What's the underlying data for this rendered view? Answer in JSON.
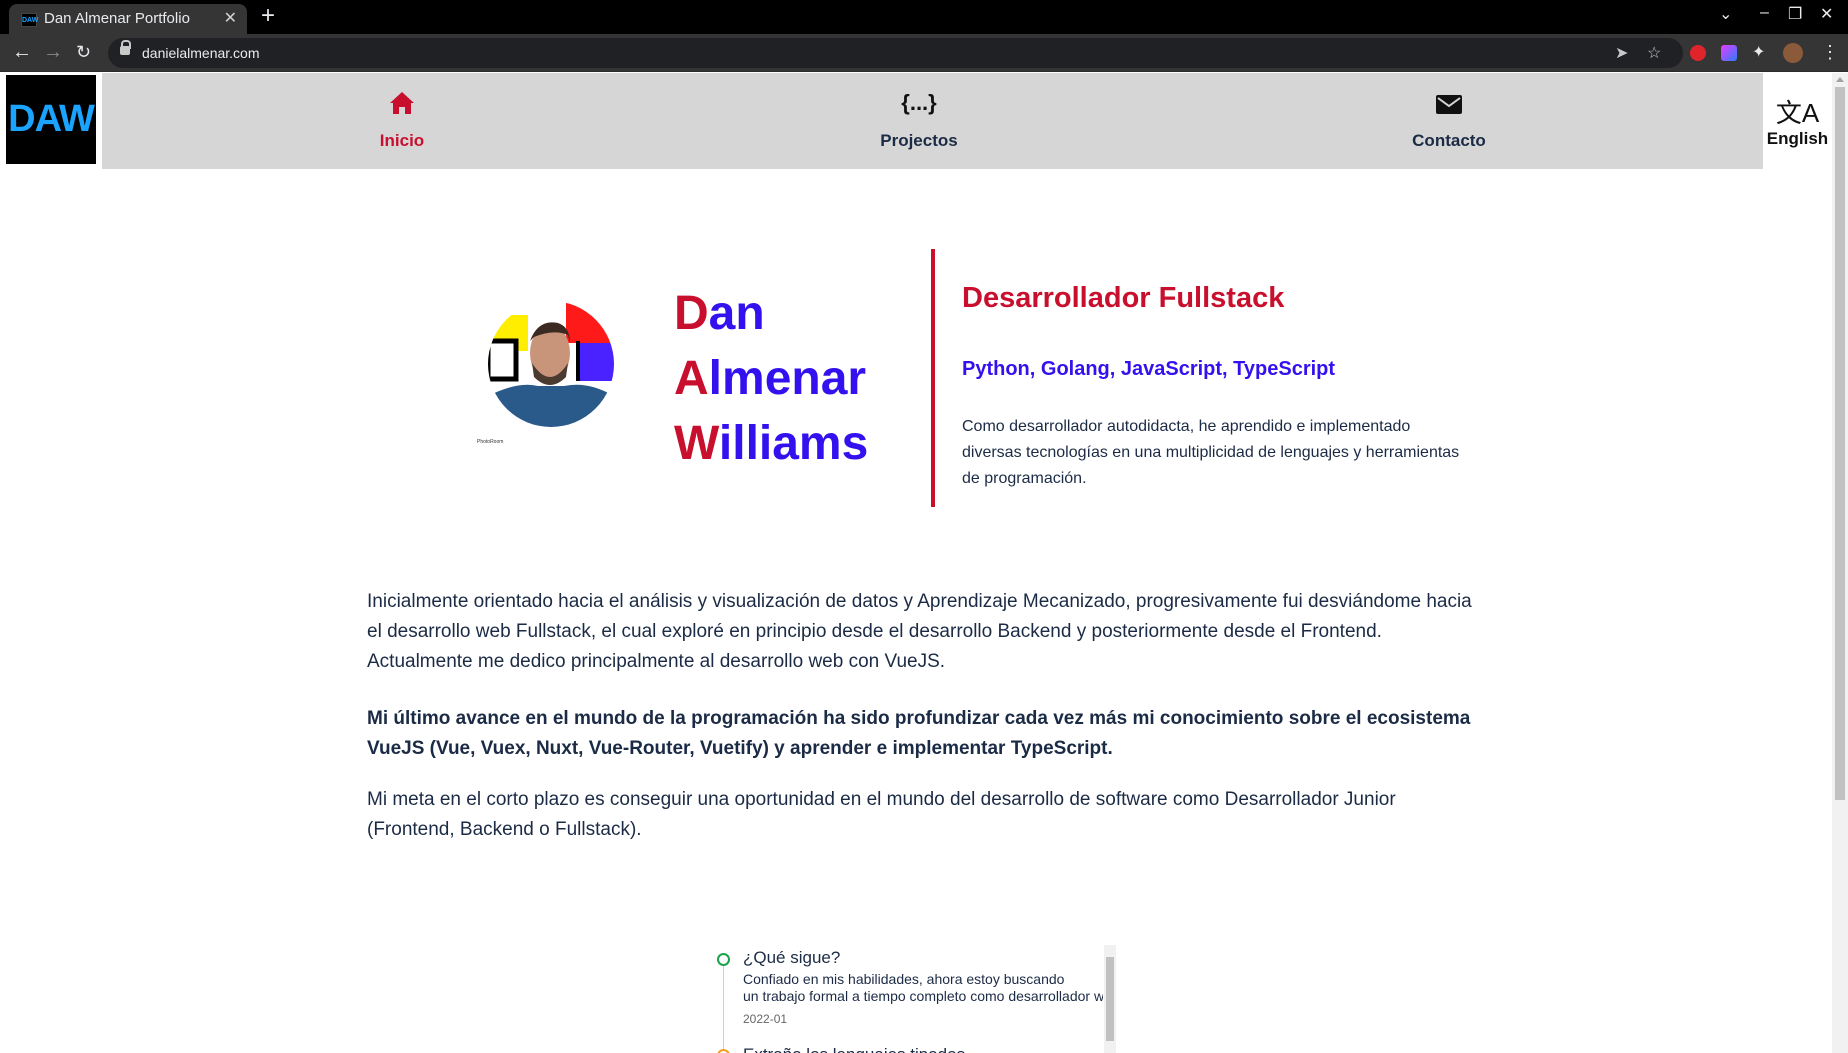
{
  "browser": {
    "tab_title": "Dan Almenar Portfolio",
    "favicon_text": "DAW",
    "url": "danielalmenar.com"
  },
  "site": {
    "logo_text": "DAW",
    "nav": [
      {
        "label": "Inicio",
        "icon": "home-icon",
        "active": true
      },
      {
        "label": "Projectos",
        "icon": "code-braces-icon",
        "active": false
      },
      {
        "label": "Contacto",
        "icon": "envelope-icon",
        "active": false
      }
    ],
    "language_label": "English",
    "code_icon_text": "{...}"
  },
  "hero": {
    "name_lines": [
      {
        "first": "D",
        "rest": "an"
      },
      {
        "first": "A",
        "rest": "lmenar"
      },
      {
        "first": "W",
        "rest": "illiams"
      }
    ],
    "avatar_credit": "PhotoRoom",
    "role_title": "Desarrollador Fullstack",
    "skills": "Python, Golang, JavaScript, TypeScript",
    "description": "Como desarrollador autodidacta, he aprendido e implementado diversas tecnologías en una multiplicidad de lenguajes y herramientas de programación."
  },
  "about": {
    "paragraph1": "Inicialmente orientado hacia el análisis y visualización de datos y Aprendizaje Mecanizado, progresivamente fui desviándome hacia el desarrollo web Fullstack, el cual exploré en principio desde el desarrollo Backend y posteriormente desde el Frontend. Actualmente me dedico principalmente al desarrollo web con VueJS.",
    "paragraph2": "Mi último avance en el mundo de la programación ha sido profundizar cada vez más mi conocimiento sobre el ecosistema VueJS (Vue, Vuex, Nuxt, Vue-Router, Vuetify) y aprender e implementar TypeScript.",
    "paragraph3": "Mi meta en el corto plazo es conseguir una oportunidad en el mundo del desarrollo de software como Desarrollador Junior (Frontend, Backend o Fullstack)."
  },
  "timeline": {
    "items": [
      {
        "title": "¿Qué sigue?",
        "desc_line1": "Confiado en mis habilidades, ahora estoy buscando",
        "desc_line2": "un trabajo formal a tiempo completo como desarrollador w",
        "date": "2022-01"
      },
      {
        "title": "Extraño los lenguajes tipados"
      }
    ]
  },
  "colors": {
    "accent_red": "#c8102e",
    "accent_blue": "#3311ee",
    "text_dark": "#1c2b45",
    "nav_bg": "#d6d6d6",
    "logo_blue": "#1aa3ff"
  }
}
